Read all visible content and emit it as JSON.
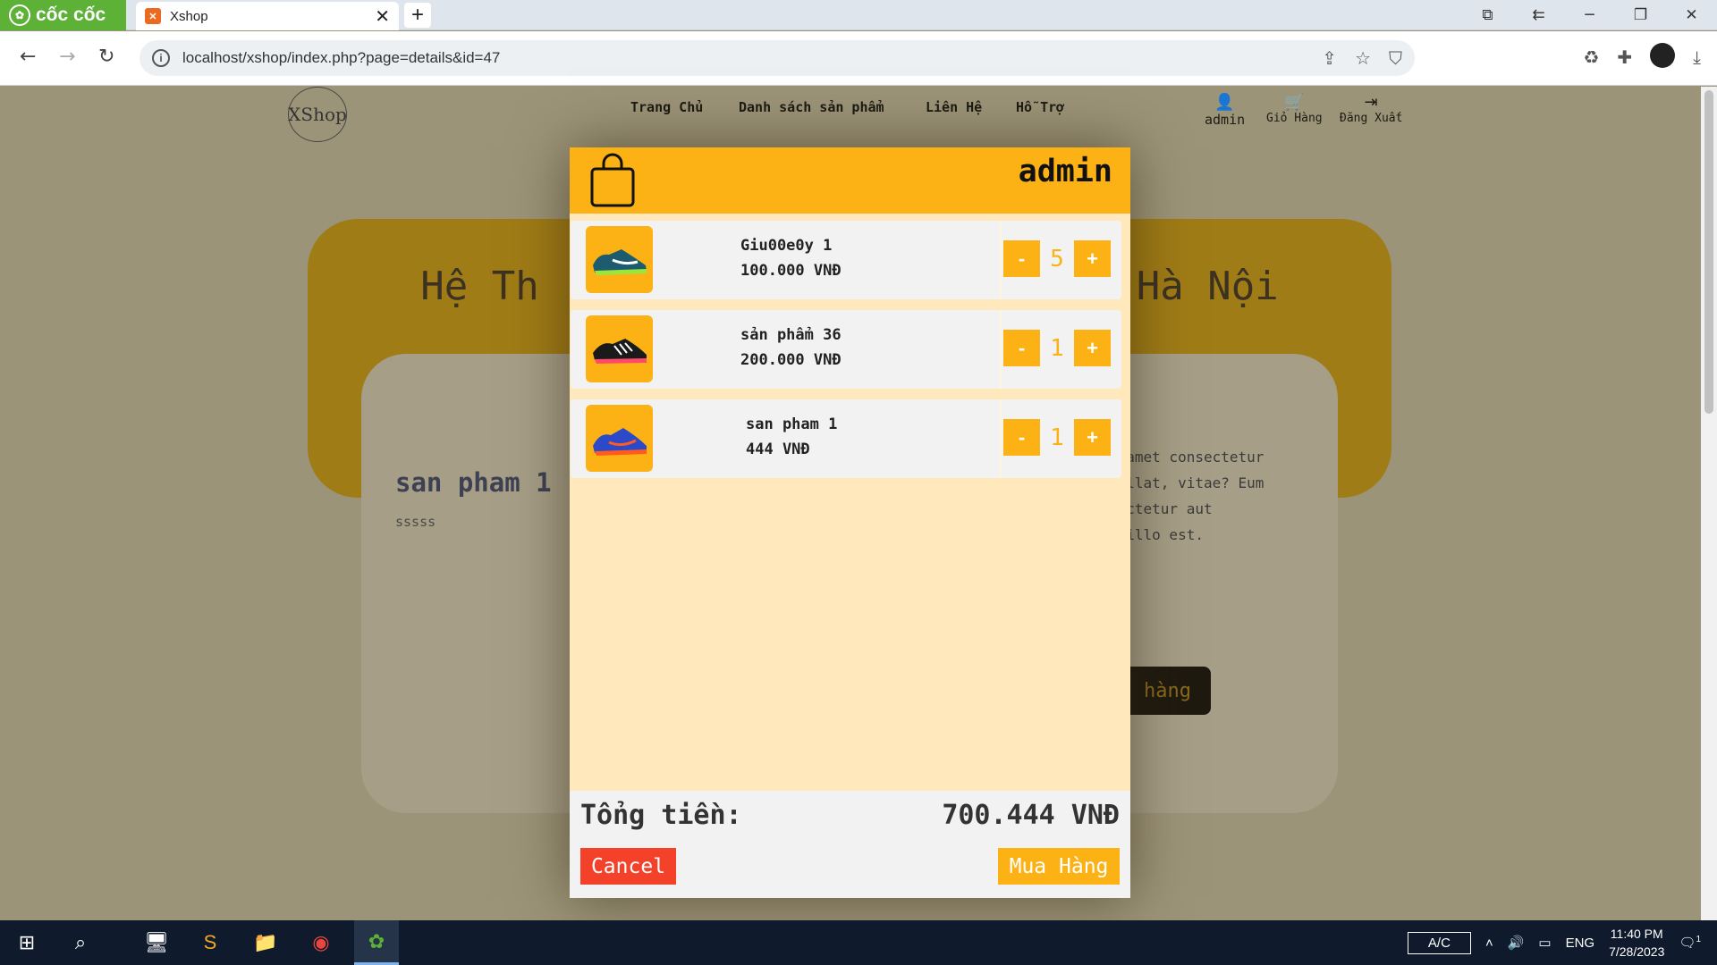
{
  "browser": {
    "brand": "cốc cốc",
    "tab_title": "Xshop",
    "tab_close": "✕",
    "new_tab": "+",
    "url": "localhost/xshop/index.php?page=details&id=47",
    "window_controls": [
      "min",
      "restore",
      "close"
    ]
  },
  "site": {
    "logo_text": "XShop",
    "nav": [
      "Trang Chủ",
      "Danh sách sản phẩm",
      "Liên Hệ",
      "Hỗ Trợ"
    ],
    "user_nav": {
      "account": "admin",
      "cart": "Giỏ Hàng",
      "logout": "Đăng Xuất"
    },
    "banner_title": "Hệ Thống Cửa Hàng Giày Hà Nội",
    "banner_left_visible": "Hệ Th",
    "banner_right_visible": "Hà Nội",
    "product_name": "san pham 1",
    "product_desc": "sssss",
    "lorem": [
      "t amet consectetur",
      "pellat, vitae? Eum",
      "sectetur aut",
      "s illo est."
    ],
    "buy_bg_label": "hàng"
  },
  "cart_modal": {
    "user": "admin",
    "items": [
      {
        "name": "Giu00e0y 1",
        "price": "100.000 VNĐ",
        "qty": "5",
        "shoe_color": "#1d5b6e",
        "accent": "#9be63b"
      },
      {
        "name": "sản phẩm 36",
        "price": "200.000 VNĐ",
        "qty": "1",
        "shoe_color": "#1a1a1a",
        "accent": "#ff4a6b"
      },
      {
        "name": "san pham 1",
        "price": "444 VNĐ",
        "qty": "1",
        "shoe_color": "#2b49c9",
        "accent": "#ff5a1f"
      }
    ],
    "minus_label": "-",
    "plus_label": "+",
    "total_label": "Tổng tiền:",
    "total_value": "700.444 VNĐ",
    "cancel_label": "Cancel",
    "buy_label": "Mua Hàng"
  },
  "taskbar": {
    "ac": "A/C",
    "lang": "ENG",
    "time": "11:40 PM",
    "date": "7/28/2023",
    "notifications": "1"
  },
  "colors": {
    "accent": "#fcb215",
    "cancel": "#f4422a",
    "modal_bg": "#ffe8bc"
  }
}
